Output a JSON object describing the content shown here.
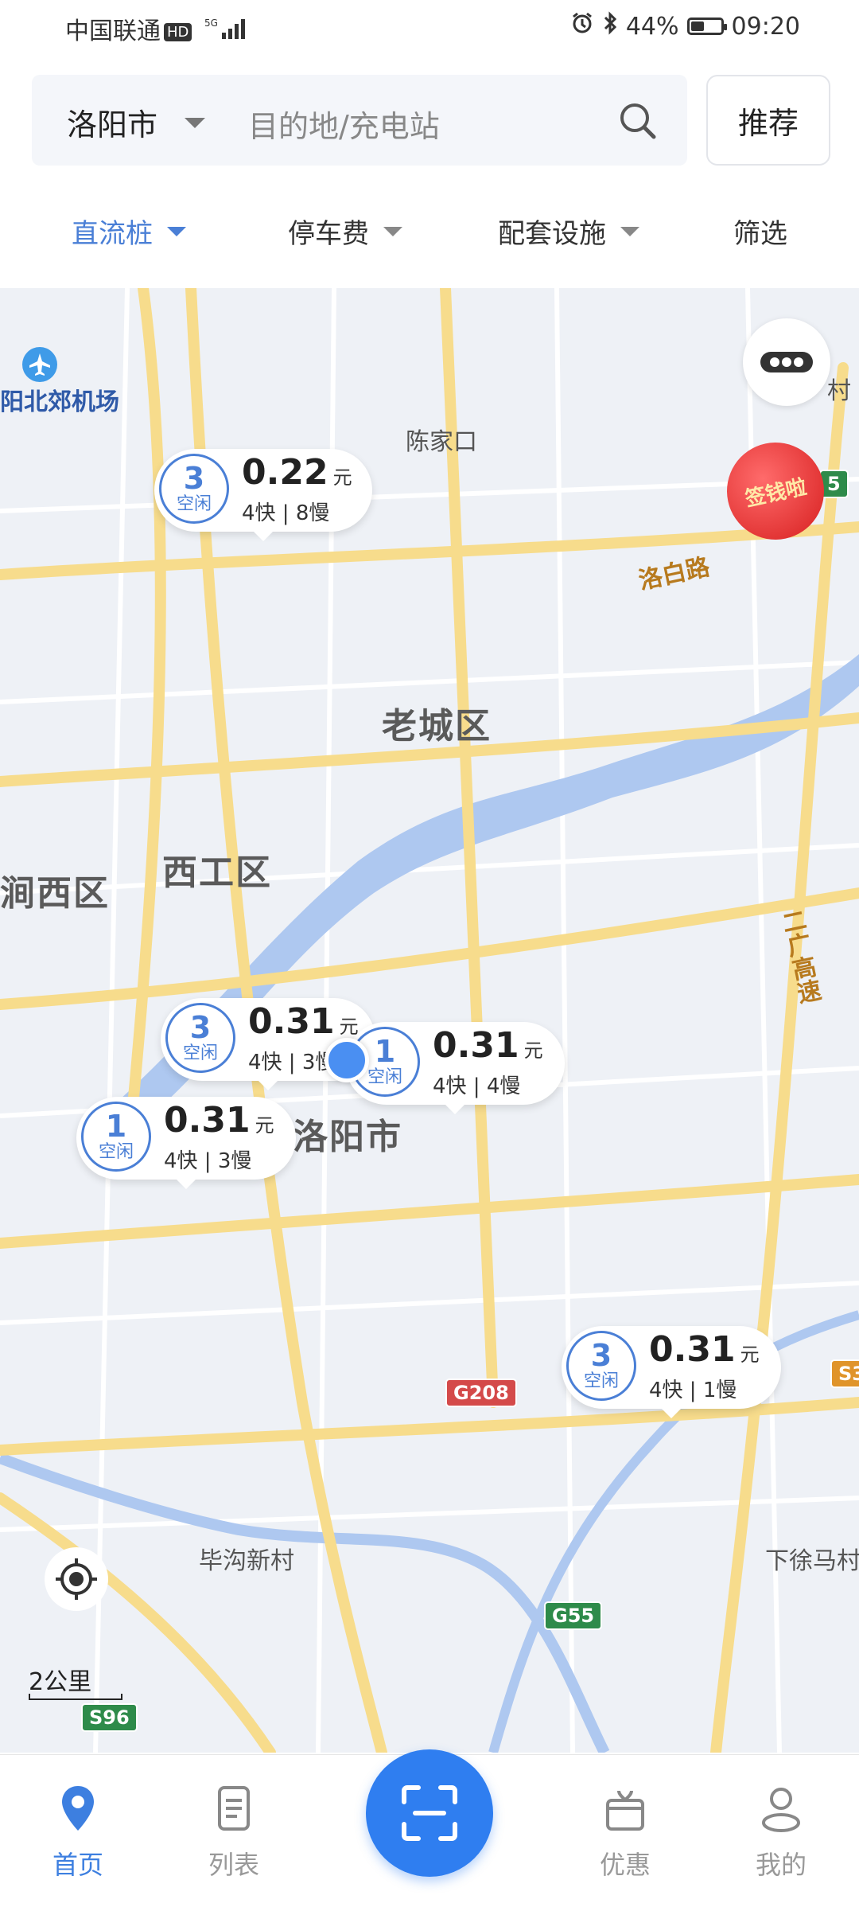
{
  "status_bar": {
    "carrier": "中国联通",
    "hd": "HD",
    "network": "5G",
    "battery": "44%",
    "time": "09:20"
  },
  "search": {
    "city": "洛阳市",
    "placeholder": "目的地/充电站",
    "recommend": "推荐"
  },
  "filters": [
    {
      "label": "直流桩",
      "active": true
    },
    {
      "label": "停车费",
      "active": false
    },
    {
      "label": "配套设施",
      "active": false
    },
    {
      "label": "筛选",
      "active": false
    }
  ],
  "map": {
    "labels": {
      "airport": "阳北郊机场",
      "chenjiakou": "陈家口",
      "laocheng": "老城区",
      "xigong": "西工区",
      "jianxi": "涧西区",
      "luoyangshi": "洛阳市",
      "luobailu": "洛白路",
      "erguang": "二广高速",
      "bigou": "毕沟新村",
      "xiaxuma": "下徐马村",
      "cun": "村"
    },
    "shields": {
      "g208": "G208",
      "g55": "G55",
      "s96": "S96",
      "s3": "S3",
      "s5": "5"
    },
    "badge": "签钱啦",
    "scale": "2公里",
    "markers": [
      {
        "count": "3",
        "status": "空闲",
        "price": "0.22",
        "unit": "元",
        "detail": "4快 | 8慢"
      },
      {
        "count": "3",
        "status": "空闲",
        "price": "0.31",
        "unit": "元",
        "detail": "4快 | 3慢"
      },
      {
        "count": "1",
        "status": "空闲",
        "price": "0.31",
        "unit": "元",
        "detail": "4快 | 4慢"
      },
      {
        "count": "1",
        "status": "空闲",
        "price": "0.31",
        "unit": "元",
        "detail": "4快 | 3慢"
      },
      {
        "count": "3",
        "status": "空闲",
        "price": "0.31",
        "unit": "元",
        "detail": "4快 | 1慢"
      }
    ]
  },
  "bottom_nav": [
    {
      "label": "首页",
      "icon": "location-pin-icon",
      "active": true
    },
    {
      "label": "列表",
      "icon": "list-icon",
      "active": false
    },
    {
      "label": "",
      "icon": "scan-icon",
      "active": false
    },
    {
      "label": "优惠",
      "icon": "gift-icon",
      "active": false
    },
    {
      "label": "我的",
      "icon": "user-icon",
      "active": false
    }
  ],
  "colors": {
    "accent": "#4a7fd6",
    "scan": "#2f7ef0",
    "map_bg": "#eef1f6",
    "river": "#aec8f0",
    "road": "#f7dc8c"
  }
}
